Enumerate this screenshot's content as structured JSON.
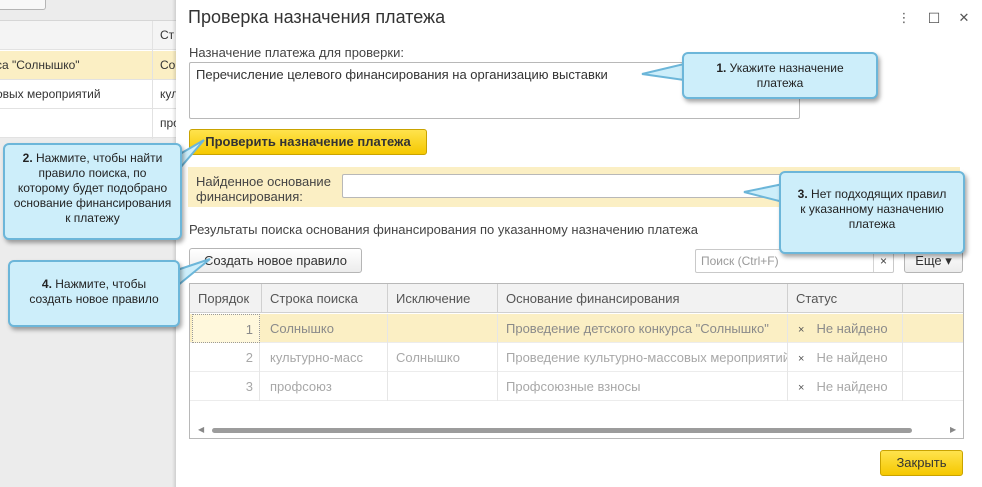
{
  "background": {
    "header_cell": "Ст",
    "rows": [
      {
        "a": "са \"Солнышко\"",
        "b": "Со"
      },
      {
        "a": "овых мероприятий",
        "b": "кул"
      },
      {
        "a": "",
        "b": "про"
      }
    ]
  },
  "dialog": {
    "title": "Проверка назначения платежа",
    "more_icon": "⋮",
    "maximize_icon": "☐",
    "close_icon": "✕",
    "purpose_label": "Назначение платежа для проверки:",
    "purpose_value": "Перечисление целевого финансирования на организацию выставки",
    "check_button": "Проверить назначение платежа",
    "found_label_line1": "Найденное основание",
    "found_label_line2": "финансирования:",
    "found_value": "",
    "results_label": "Результаты поиска основания финансирования по указанному назначению платежа",
    "create_rule_button": "Создать новое правило",
    "search_placeholder": "Поиск (Ctrl+F)",
    "search_clear": "×",
    "more_button": "Еще ▾",
    "close_button": "Закрыть"
  },
  "table": {
    "headers": [
      "Порядок",
      "Строка поиска",
      "Исключение",
      "Основание финансирования",
      "Статус"
    ],
    "rows": [
      {
        "order": "1",
        "search": "Солнышко",
        "exclusion": "",
        "basis": "Проведение детского конкурса \"Солнышко\"",
        "status": "Не найдено",
        "status_icon": "×"
      },
      {
        "order": "2",
        "search": "культурно-масс",
        "exclusion": "Солнышко",
        "basis": "Проведение культурно-массовых мероприятий",
        "status": "Не найдено",
        "status_icon": "×"
      },
      {
        "order": "3",
        "search": "профсоюз",
        "exclusion": "",
        "basis": "Профсоюзные взносы",
        "status": "Не найдено",
        "status_icon": "×"
      }
    ]
  },
  "callouts": {
    "c1": {
      "num": "1.",
      "text_line1": " Укажите назначение",
      "text_line2": "платежа"
    },
    "c2": {
      "num": "2.",
      "text_line1": " Нажмите, чтобы найти",
      "text_line2": "правило поиска, по",
      "text_line3": "которому будет подобрано",
      "text_line4": "основание финансирования",
      "text_line5": "к платежу"
    },
    "c3": {
      "num": "3.",
      "text_line1": " Нет подходящих правил",
      "text_line2": "к указанному назначению",
      "text_line3": "платежа"
    },
    "c4": {
      "num": "4.",
      "text_line1": " Нажмите, чтобы",
      "text_line2": "создать новое правило"
    }
  }
}
